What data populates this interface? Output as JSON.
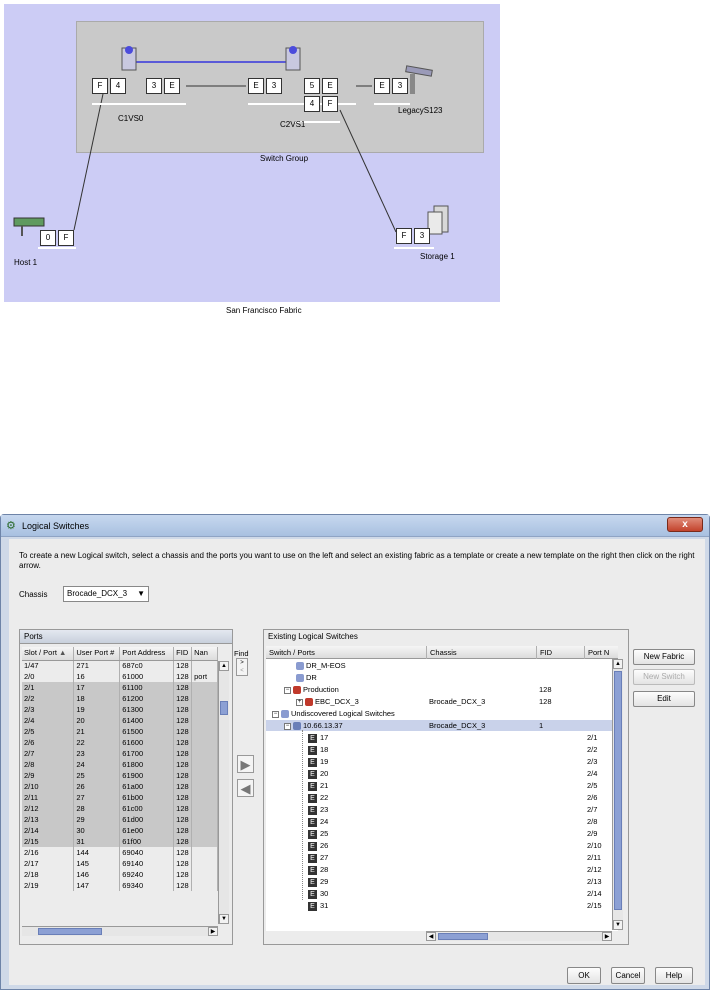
{
  "topology": {
    "group_label": "Switch Group",
    "fabric_label": "San Francisco Fabric",
    "switches": [
      {
        "name": "C1VS0",
        "ports": [
          "F",
          "4",
          "3",
          "E"
        ]
      },
      {
        "name": "C2VS1",
        "ports": [
          "E",
          "3",
          "5",
          "E",
          "4",
          "F"
        ]
      },
      {
        "name": "LegacyS123",
        "ports": [
          "E",
          "3"
        ]
      }
    ],
    "host": {
      "name": "Host 1",
      "ports": [
        "0",
        "F"
      ]
    },
    "storage": {
      "name": "Storage 1",
      "ports": [
        "F",
        "3"
      ]
    }
  },
  "dialog": {
    "title": "Logical Switches",
    "close_label": "x",
    "instruction": "To create a new Logical switch, select a chassis and the ports you want to use on the left and select an existing fabric as a template or create a new template on the right then click on the right arrow.",
    "chassis_label": "Chassis",
    "chassis_value": "Brocade_DCX_3",
    "ports_panel": {
      "title": "Ports",
      "columns": [
        "Slot / Port",
        "User Port #",
        "Port Address",
        "FID",
        "Nan"
      ],
      "rows": [
        {
          "slot": "1/47",
          "user": "271",
          "addr": "687c0",
          "fid": "128",
          "name": "",
          "sel": false
        },
        {
          "slot": "2/0",
          "user": "16",
          "addr": "61000",
          "fid": "128",
          "name": "port",
          "sel": false
        },
        {
          "slot": "2/1",
          "user": "17",
          "addr": "61100",
          "fid": "128",
          "name": "",
          "sel": true
        },
        {
          "slot": "2/2",
          "user": "18",
          "addr": "61200",
          "fid": "128",
          "name": "",
          "sel": true
        },
        {
          "slot": "2/3",
          "user": "19",
          "addr": "61300",
          "fid": "128",
          "name": "",
          "sel": true
        },
        {
          "slot": "2/4",
          "user": "20",
          "addr": "61400",
          "fid": "128",
          "name": "",
          "sel": true
        },
        {
          "slot": "2/5",
          "user": "21",
          "addr": "61500",
          "fid": "128",
          "name": "",
          "sel": true
        },
        {
          "slot": "2/6",
          "user": "22",
          "addr": "61600",
          "fid": "128",
          "name": "",
          "sel": true
        },
        {
          "slot": "2/7",
          "user": "23",
          "addr": "61700",
          "fid": "128",
          "name": "",
          "sel": true
        },
        {
          "slot": "2/8",
          "user": "24",
          "addr": "61800",
          "fid": "128",
          "name": "",
          "sel": true
        },
        {
          "slot": "2/9",
          "user": "25",
          "addr": "61900",
          "fid": "128",
          "name": "",
          "sel": true
        },
        {
          "slot": "2/10",
          "user": "26",
          "addr": "61a00",
          "fid": "128",
          "name": "",
          "sel": true
        },
        {
          "slot": "2/11",
          "user": "27",
          "addr": "61b00",
          "fid": "128",
          "name": "",
          "sel": true
        },
        {
          "slot": "2/12",
          "user": "28",
          "addr": "61c00",
          "fid": "128",
          "name": "",
          "sel": true
        },
        {
          "slot": "2/13",
          "user": "29",
          "addr": "61d00",
          "fid": "128",
          "name": "",
          "sel": true
        },
        {
          "slot": "2/14",
          "user": "30",
          "addr": "61e00",
          "fid": "128",
          "name": "",
          "sel": true
        },
        {
          "slot": "2/15",
          "user": "31",
          "addr": "61f00",
          "fid": "128",
          "name": "",
          "sel": true
        },
        {
          "slot": "2/16",
          "user": "144",
          "addr": "69040",
          "fid": "128",
          "name": "",
          "sel": false
        },
        {
          "slot": "2/17",
          "user": "145",
          "addr": "69140",
          "fid": "128",
          "name": "",
          "sel": false
        },
        {
          "slot": "2/18",
          "user": "146",
          "addr": "69240",
          "fid": "128",
          "name": "",
          "sel": false
        },
        {
          "slot": "2/19",
          "user": "147",
          "addr": "69340",
          "fid": "128",
          "name": "",
          "sel": false
        }
      ]
    },
    "find_label": "Find",
    "find_button": ">",
    "find_button2": "<",
    "move_right": "▶",
    "move_left": "◀",
    "els_panel": {
      "title": "Existing Logical Switches",
      "columns": [
        "Switch / Ports",
        "Chassis",
        "FID",
        "Port N"
      ],
      "rows": [
        {
          "indent": 2,
          "exp": "",
          "icon": "fabric",
          "label": "DR_M-EOS",
          "chassis": "",
          "fid": "",
          "portn": "",
          "hl": false
        },
        {
          "indent": 2,
          "exp": "",
          "icon": "fabric",
          "label": "DR",
          "chassis": "",
          "fid": "",
          "portn": "",
          "hl": false
        },
        {
          "indent": 1,
          "exp": "−",
          "icon": "fabric-red",
          "label": "Production",
          "chassis": "",
          "fid": "128",
          "portn": "",
          "hl": false
        },
        {
          "indent": 2,
          "exp": "+",
          "icon": "switch-red",
          "label": "EBC_DCX_3",
          "chassis": "Brocade_DCX_3",
          "fid": "128",
          "portn": "",
          "hl": false
        },
        {
          "indent": 0,
          "exp": "−",
          "icon": "fabric",
          "label": "Undiscovered Logical Switches",
          "chassis": "",
          "fid": "",
          "portn": "",
          "hl": false
        },
        {
          "indent": 1,
          "exp": "−",
          "icon": "switch",
          "label": "10.66.13.37",
          "chassis": "Brocade_DCX_3",
          "fid": "1",
          "portn": "",
          "hl": true
        },
        {
          "indent": 3,
          "exp": "",
          "icon": "port",
          "label": "17",
          "chassis": "",
          "fid": "",
          "portn": "2/1",
          "hl": false
        },
        {
          "indent": 3,
          "exp": "",
          "icon": "port",
          "label": "18",
          "chassis": "",
          "fid": "",
          "portn": "2/2",
          "hl": false
        },
        {
          "indent": 3,
          "exp": "",
          "icon": "port",
          "label": "19",
          "chassis": "",
          "fid": "",
          "portn": "2/3",
          "hl": false
        },
        {
          "indent": 3,
          "exp": "",
          "icon": "port",
          "label": "20",
          "chassis": "",
          "fid": "",
          "portn": "2/4",
          "hl": false
        },
        {
          "indent": 3,
          "exp": "",
          "icon": "port",
          "label": "21",
          "chassis": "",
          "fid": "",
          "portn": "2/5",
          "hl": false
        },
        {
          "indent": 3,
          "exp": "",
          "icon": "port",
          "label": "22",
          "chassis": "",
          "fid": "",
          "portn": "2/6",
          "hl": false
        },
        {
          "indent": 3,
          "exp": "",
          "icon": "port",
          "label": "23",
          "chassis": "",
          "fid": "",
          "portn": "2/7",
          "hl": false
        },
        {
          "indent": 3,
          "exp": "",
          "icon": "port",
          "label": "24",
          "chassis": "",
          "fid": "",
          "portn": "2/8",
          "hl": false
        },
        {
          "indent": 3,
          "exp": "",
          "icon": "port",
          "label": "25",
          "chassis": "",
          "fid": "",
          "portn": "2/9",
          "hl": false
        },
        {
          "indent": 3,
          "exp": "",
          "icon": "port",
          "label": "26",
          "chassis": "",
          "fid": "",
          "portn": "2/10",
          "hl": false
        },
        {
          "indent": 3,
          "exp": "",
          "icon": "port",
          "label": "27",
          "chassis": "",
          "fid": "",
          "portn": "2/11",
          "hl": false
        },
        {
          "indent": 3,
          "exp": "",
          "icon": "port",
          "label": "28",
          "chassis": "",
          "fid": "",
          "portn": "2/12",
          "hl": false
        },
        {
          "indent": 3,
          "exp": "",
          "icon": "port",
          "label": "29",
          "chassis": "",
          "fid": "",
          "portn": "2/13",
          "hl": false
        },
        {
          "indent": 3,
          "exp": "",
          "icon": "port",
          "label": "30",
          "chassis": "",
          "fid": "",
          "portn": "2/14",
          "hl": false
        },
        {
          "indent": 3,
          "exp": "",
          "icon": "port",
          "label": "31",
          "chassis": "",
          "fid": "",
          "portn": "2/15",
          "hl": false
        }
      ]
    },
    "buttons": {
      "new_fabric": "New Fabric",
      "new_switch": "New Switch",
      "edit": "Edit",
      "ok": "OK",
      "cancel": "Cancel",
      "help": "Help"
    }
  }
}
